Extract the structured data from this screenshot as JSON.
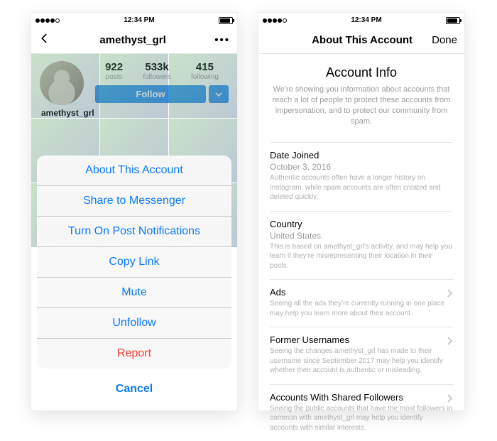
{
  "status": {
    "time": "12:34 PM"
  },
  "left": {
    "nav_title": "amethyst_grl",
    "username": "amethyst_grl",
    "stats": {
      "posts": {
        "n": "922",
        "l": "posts"
      },
      "followers": {
        "n": "533k",
        "l": "followers"
      },
      "following": {
        "n": "415",
        "l": "following"
      }
    },
    "follow_label": "Follow",
    "sheet": [
      "About This Account",
      "Share to Messenger",
      "Turn On Post Notifications",
      "Copy Link",
      "Mute",
      "Unfollow",
      "Report"
    ],
    "cancel": "Cancel"
  },
  "right": {
    "nav_title": "About This Account",
    "done": "Done",
    "heading": "Account Info",
    "subheading": "We're showing you information about accounts that reach a lot of people to protect these accounts from impersonation, and to protect our community from spam.",
    "sections": {
      "date_joined": {
        "h": "Date Joined",
        "v": "October 3, 2016",
        "d": "Authentic accounts often have a longer history on Instagram, while spam accounts are often created and deleted quickly."
      },
      "country": {
        "h": "Country",
        "v": "United States",
        "d": "This is based on amethyst_grl's activity, and may help you learn if they're misrepresenting their location in their posts."
      },
      "ads": {
        "h": "Ads",
        "d": "Seeing all the ads they're currently running in one place may help you learn more about their account."
      },
      "former": {
        "h": "Former Usernames",
        "d": "Seeing the changes amethyst_grl has made to their username since September 2017 may help you identify whether their account is authentic or misleading."
      },
      "shared": {
        "h": "Accounts With Shared Followers",
        "d": "Seeing the public accounts that have the most followers in common with amethyst_grl may help you identify accounts with similar interests."
      }
    }
  }
}
